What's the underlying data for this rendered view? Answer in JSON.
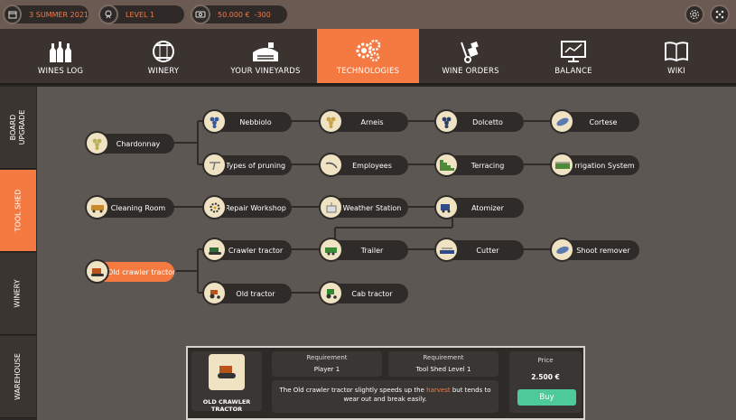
{
  "status_bar": {
    "date": "3 SUMMER 2021",
    "level": "LEVEL 1",
    "money": "50.000 €",
    "money_change": "-300"
  },
  "nav": {
    "tabs": [
      {
        "label": "WINES LOG",
        "icon": "wine-bottles-icon"
      },
      {
        "label": "WINERY",
        "icon": "barrel-icon"
      },
      {
        "label": "YOUR VINEYARDS",
        "icon": "vineyard-icon"
      },
      {
        "label": "TECHNOLOGIES",
        "icon": "gears-icon",
        "active": true
      },
      {
        "label": "WINE ORDERS",
        "icon": "hand-truck-icon"
      },
      {
        "label": "BALANCE",
        "icon": "monitor-chart-icon"
      },
      {
        "label": "WIKI",
        "icon": "book-icon"
      }
    ]
  },
  "side_tabs": [
    {
      "label": "BOARD UPGRADE"
    },
    {
      "label": "TOOL SHED",
      "active": true
    },
    {
      "label": "WINERY"
    },
    {
      "label": "WAREHOUSE"
    }
  ],
  "tree": {
    "chardonnay": "Chardonnay",
    "nebbiolo": "Nebbiolo",
    "arneis": "Arneis",
    "dolcetto": "Dolcetto",
    "cortese": "Cortese",
    "types_of_pruning": "Types of pruning",
    "employees": "Employees",
    "terracing": "Terracing",
    "irrigation_system": "Irrigation System",
    "cleaning_room": "Cleaning Room",
    "repair_workshop": "Repair Workshop",
    "weather_station": "Weather Station",
    "atomizer": "Atomizer",
    "old_crawler_tractor": "Old crawler tractor",
    "crawler_tractor": "Crawler tractor",
    "trailer": "Trailer",
    "cutter": "Cutter",
    "shoot_remover": "Shoot remover",
    "old_tractor": "Old tractor",
    "cab_tractor": "Cab tractor"
  },
  "detail": {
    "name": "OLD CRAWLER TRACTOR",
    "req1_title": "Requirement",
    "req1_value": "Player 1",
    "req2_title": "Requirement",
    "req2_value": "Tool Shed Level 1",
    "desc_before": "The Old crawler tractor slightly speeds up the ",
    "desc_highlight": "harvest",
    "desc_after": " but tends to wear out and break easily.",
    "price_title": "Price",
    "price_value": "2.500 €",
    "buy_label": "Buy"
  },
  "colors": {
    "accent": "#f47a42",
    "buy": "#4ec99a"
  }
}
